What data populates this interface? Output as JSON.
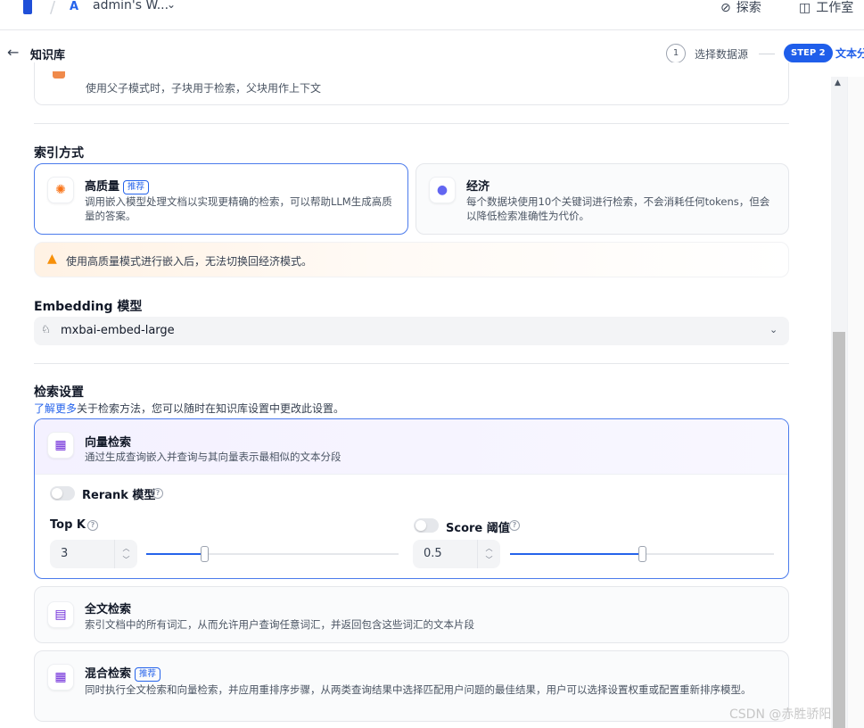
{
  "topbar": {
    "workspace_initial": "A",
    "workspace_name": "admin's W...",
    "explore": "探索",
    "studio": "工作室"
  },
  "subbar": {
    "title": "知识库",
    "step1_number": "1",
    "step1_label": "选择数据源",
    "step2_badge": "STEP 2",
    "step2_label": "文本分"
  },
  "parent_child_desc": "使用父子模式时，子块用于检索，父块用作上下文",
  "index_method": {
    "title": "索引方式",
    "high_quality": {
      "title": "高质量",
      "badge": "推荐",
      "desc": "调用嵌入模型处理文档以实现更精确的检索，可以帮助LLM生成高质量的答案。"
    },
    "economy": {
      "title": "经济",
      "desc": "每个数据块使用10个关键词进行检索，不会消耗任何tokens，但会以降低检索准确性为代价。"
    },
    "warning": "使用高质量模式进行嵌入后，无法切换回经济模式。"
  },
  "embedding": {
    "title": "Embedding 模型",
    "value": "mxbai-embed-large"
  },
  "retrieval": {
    "title": "检索设置",
    "learn_more": "了解更多",
    "learn_more_rest": "关于检索方法，您可以随时在知识库设置中更改此设置。",
    "vector": {
      "title": "向量检索",
      "desc": "通过生成查询嵌入并查询与其向量表示最相似的文本分段",
      "rerank_label": "Rerank 模型",
      "topk_label": "Top K",
      "topk_value": "3",
      "topk_fraction": 0.23,
      "score_label": "Score 阈值",
      "score_value": "0.5",
      "score_fraction": 0.5
    },
    "fulltext": {
      "title": "全文检索",
      "desc": "索引文档中的所有词汇，从而允许用户查询任意词汇，并返回包含这些词汇的文本片段"
    },
    "hybrid": {
      "title": "混合检索",
      "badge": "推荐",
      "desc": "同时执行全文检索和向量检索，并应用重排序步骤，从两类查询结果中选择匹配用户问题的最佳结果，用户可以选择设置权重或配置重新排序模型。"
    }
  },
  "watermark": "CSDN @赤胜骄阳",
  "colors": {
    "accent": "#1f5eea",
    "warning": "#f79009"
  }
}
